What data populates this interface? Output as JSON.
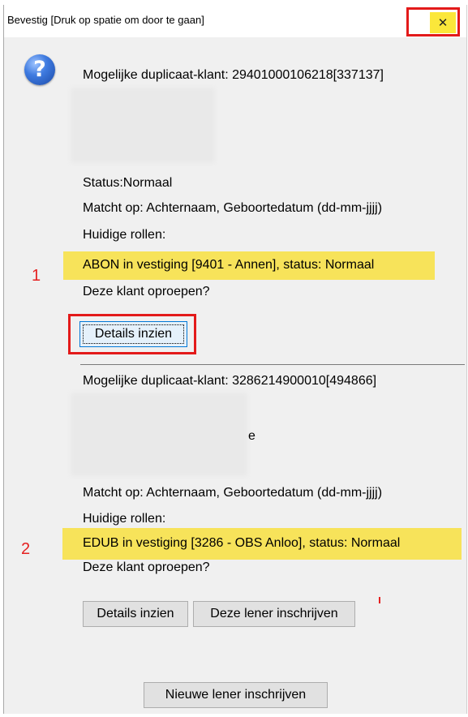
{
  "window": {
    "title": "Bevestig [Druk op spatie om door te gaan]",
    "close_symbol": "✕"
  },
  "icon": "question-icon",
  "entries": [
    {
      "number": "1",
      "header": "Mogelijke duplicaat-klant: 29401000106218[337137]",
      "status": "Status:Normaal",
      "match": "Matcht op: Achternaam, Geboortedatum (dd-mm-jjjj)",
      "roles_label": "Huidige rollen:",
      "role": "ABON in vestiging [9401 - Annen], status: Normaal",
      "question": "Deze klant oproepen?",
      "details_button": "Details inzien"
    },
    {
      "number": "2",
      "header": "Mogelijke duplicaat-klant: 3286214900010[494866]",
      "partial_text": "e",
      "match": "Matcht op: Achternaam, Geboortedatum (dd-mm-jjjj)",
      "roles_label": "Huidige rollen:",
      "role": "EDUB in vestiging [3286 - OBS Anloo], status: Normaal",
      "question": "Deze klant oproepen?",
      "details_button": "Details inzien",
      "register_button": "Deze lener inschrijven"
    }
  ],
  "footer": {
    "new_button": "Nieuwe lener inschrijven"
  },
  "colors": {
    "highlight": "#f7e35a",
    "annotation_red": "#e31a1a",
    "dialog_bg": "#f0f0f0"
  }
}
